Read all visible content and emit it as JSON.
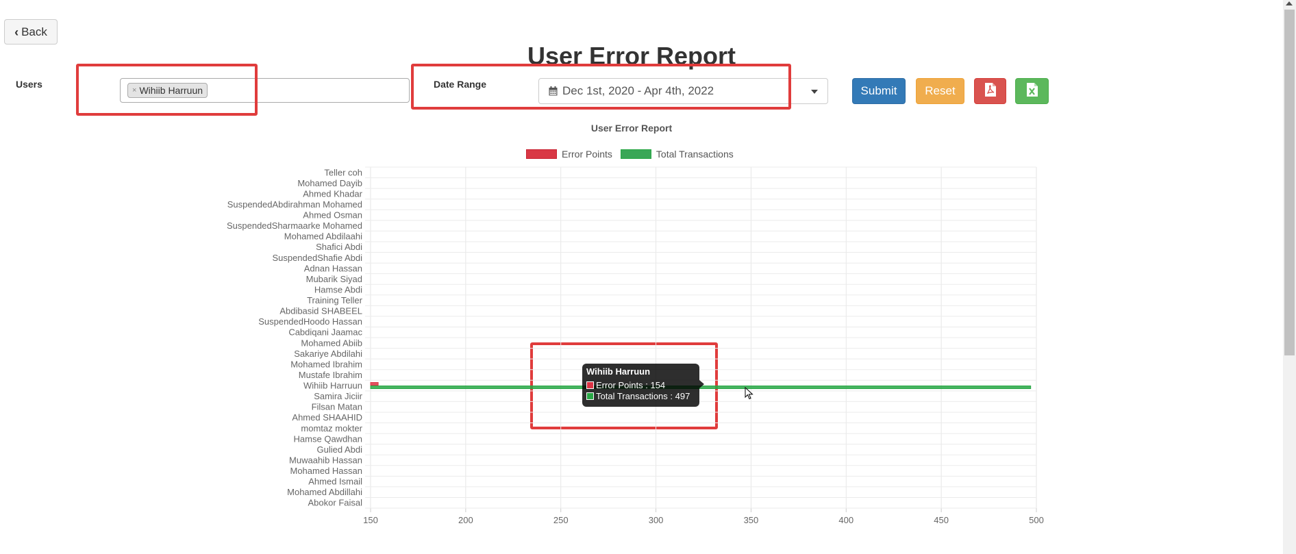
{
  "back_button": {
    "label": "Back"
  },
  "page_title": "User Error Report",
  "filters": {
    "users_label": "Users",
    "selected_user_tag": "Wihiib Harruun",
    "date_range_label": "Date Range",
    "date_range_value": "Dec 1st, 2020 - Apr 4th, 2022"
  },
  "buttons": {
    "submit": "Submit",
    "reset": "Reset",
    "pdf_icon": "file-pdf-icon",
    "excel_icon": "file-excel-icon"
  },
  "colors": {
    "error_points": "#dc3545",
    "total_transactions": "#28a745",
    "highlight": "#e03c3c"
  },
  "chart_data": {
    "type": "bar",
    "orientation": "horizontal",
    "title": "User Error Report",
    "legend_position": "top",
    "grid": true,
    "xlim": [
      150,
      500
    ],
    "x_ticks": [
      150,
      200,
      250,
      300,
      350,
      400,
      450,
      500
    ],
    "categories": [
      "Teller coh",
      "Mohamed Dayib",
      "Ahmed Khadar",
      "SuspendedAbdirahman Mohamed",
      "Ahmed Osman",
      "SuspendedSharmaarke Mohamed",
      "Mohamed Abdilaahi",
      "Shafici Abdi",
      "SuspendedShafie Abdi",
      "Adnan Hassan",
      "Mubarik Siyad",
      "Hamse Abdi",
      "Training Teller",
      "Abdibasid SHABEEL",
      "SuspendedHoodo Hassan",
      "Cabdiqani Jaamac",
      "Mohamed Abiib",
      "Sakariye Abdilahi",
      "Mohamed Ibrahim",
      "Mustafe Ibrahim",
      "Wihiib Harruun",
      "Samira Jiciir",
      "Filsan Matan",
      "Ahmed SHAAHID",
      "momtaz mokter",
      "Hamse Qawdhan",
      "Gulied Abdi",
      "Muwaahib Hassan",
      "Mohamed Hassan",
      "Ahmed Ismail",
      "Mohamed Abdillahi",
      "Abokor Faisal"
    ],
    "series": [
      {
        "name": "Error Points",
        "values": [
          0,
          0,
          0,
          0,
          0,
          0,
          0,
          0,
          0,
          0,
          0,
          0,
          0,
          0,
          0,
          0,
          0,
          0,
          0,
          0,
          154,
          0,
          0,
          0,
          0,
          0,
          0,
          0,
          0,
          0,
          0,
          0
        ]
      },
      {
        "name": "Total Transactions",
        "values": [
          0,
          0,
          0,
          0,
          0,
          0,
          0,
          0,
          0,
          0,
          0,
          0,
          0,
          0,
          0,
          0,
          0,
          0,
          0,
          0,
          497,
          0,
          0,
          0,
          0,
          0,
          0,
          0,
          0,
          0,
          0,
          0
        ]
      }
    ]
  },
  "tooltip": {
    "title": "Wihiib Harruun",
    "line1": "Error Points : 154",
    "line2": "Total Transactions : 497"
  }
}
